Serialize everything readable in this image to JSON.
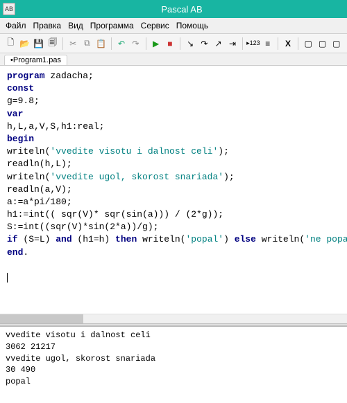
{
  "window": {
    "title": "Pascal AB",
    "icon_label": "AB"
  },
  "menu": {
    "file": "Файл",
    "edit": "Правка",
    "view": "Вид",
    "program": "Программа",
    "service": "Сервис",
    "help": "Помощь"
  },
  "toolbar": {
    "new": "🗋",
    "open": "📂",
    "save": "💾",
    "saveall": "🗐",
    "cut": "✂",
    "copy": "⧉",
    "paste": "📋",
    "undo": "↶",
    "redo": "↷",
    "run": "▶",
    "stop": "■",
    "stepinto": "↘",
    "stepover": "↷",
    "stepout": "↗",
    "trace": "⇥",
    "btn123": "▸123",
    "btnlist": "≡",
    "btnx": "X",
    "btn1": "▢",
    "btn2": "▢",
    "btn3": "▢"
  },
  "tab": {
    "name": "•Program1.pas"
  },
  "code": {
    "l1a": "program",
    "l1b": " zadacha;",
    "l2": "const",
    "l3": "g=9.8;",
    "l4": "var",
    "l5": "h,L,a,V,S,h1:real;",
    "l6": "begin",
    "l7a": "writeln(",
    "l7b": "'vvedite visotu i dalnost celi'",
    "l7c": ");",
    "l8": "readln(h,L);",
    "l9a": "writeln(",
    "l9b": "'vvedite ugol, skorost snariada'",
    "l9c": ");",
    "l10": "readln(a,V);",
    "l11": "a:=a*pi/180;",
    "l12": "h1:=int(( sqr(V)* sqr(sin(a))) / (2*g));",
    "l13": "S:=int((sqr(V)*sin(2*a))/g);",
    "l14a": "if",
    "l14b": " (S=L) ",
    "l14c": "and",
    "l14d": " (h1=h) ",
    "l14e": "then",
    "l14f": " writeln(",
    "l14g": "'popal'",
    "l14h": ") ",
    "l14i": "else",
    "l14j": " writeln(",
    "l14k": "'ne popal'",
    "l14l": ");",
    "l15": "end",
    "l15b": "."
  },
  "output": {
    "l1": "vvedite visotu i dalnost celi",
    "l2": "3062 21217",
    "l3": "vvedite ugol, skorost snariada",
    "l4": "30 490",
    "l5": "popal"
  }
}
